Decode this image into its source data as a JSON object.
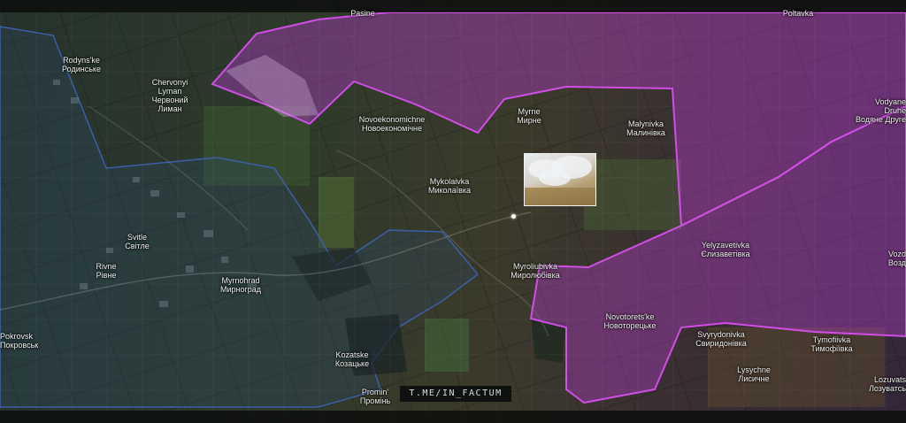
{
  "colors": {
    "occupied_fill": "#b43cc8",
    "occupied_border": "#d04ee6",
    "contested_border": "#3b5fa8"
  },
  "watermark": "T.ME/IN_FACTUM",
  "places": [
    {
      "id": "pasine",
      "lat": "Pasine",
      "cyr": ""
    },
    {
      "id": "poltavka",
      "lat": "Poltavka",
      "cyr": ""
    },
    {
      "id": "rodynske",
      "lat": "Rodyns'ke",
      "cyr": "Родинське"
    },
    {
      "id": "chervonyi-lyman",
      "lat": "Chervonyi",
      "lat2": "Lyman",
      "cyr": "Червоний",
      "cyr2": "Лиман"
    },
    {
      "id": "novoekonomichne",
      "lat": "Novoekonomichne",
      "cyr": "Новоекономічне"
    },
    {
      "id": "myrne",
      "lat": "Myrne",
      "cyr": "Мирне"
    },
    {
      "id": "malynivka",
      "lat": "Malynivka",
      "cyr": "Малинівка"
    },
    {
      "id": "vodyane-druhe",
      "lat": "Vodyane",
      "lat2": "Druhe",
      "cyr": "Водяне Друге"
    },
    {
      "id": "mykolaivka",
      "lat": "Mykolaivka",
      "cyr": "Миколаївка"
    },
    {
      "id": "svitle",
      "lat": "Svitle",
      "cyr": "Світле"
    },
    {
      "id": "rivne",
      "lat": "Rivne",
      "cyr": "Рівне"
    },
    {
      "id": "myrnohrad",
      "lat": "Myrnohrad",
      "cyr": "Мирноград"
    },
    {
      "id": "yelyzavetivka",
      "lat": "Yelyzavetivka",
      "cyr": "Єлизаветівка"
    },
    {
      "id": "vozd",
      "lat": "Vozd",
      "cyr": "Возд"
    },
    {
      "id": "myroliubivka",
      "lat": "Myroliubivka",
      "cyr": "Миролюбівка"
    },
    {
      "id": "pokrovsk",
      "lat": "Pokrovsk",
      "cyr": "Покровськ"
    },
    {
      "id": "novotoretske",
      "lat": "Novotorets'ke",
      "cyr": "Новоторецьке"
    },
    {
      "id": "svyrydonivka",
      "lat": "Svyrydonivka",
      "cyr": "Свиридонівка"
    },
    {
      "id": "tymofiivka",
      "lat": "Tymofiivka",
      "cyr": "Тимофіївка"
    },
    {
      "id": "kozatske",
      "lat": "Kozatske",
      "cyr": "Козацьке"
    },
    {
      "id": "lysychne",
      "lat": "Lysychne",
      "cyr": "Лисичне"
    },
    {
      "id": "lozuvatske",
      "lat": "Lozuvats",
      "cyr": "Лозуватсь"
    },
    {
      "id": "promin",
      "lat": "Promin'",
      "cyr": "Промінь"
    }
  ]
}
